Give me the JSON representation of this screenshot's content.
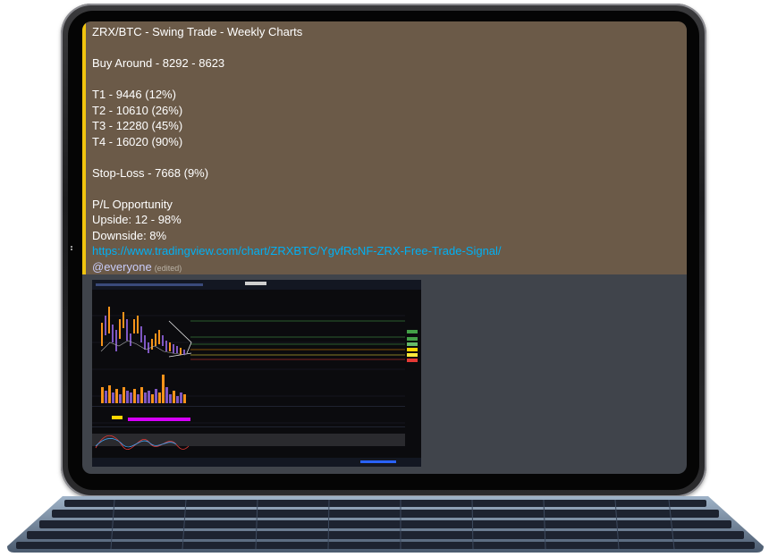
{
  "message": {
    "lines": [
      {
        "key": "title",
        "text": "ZRX/BTC - Swing Trade - Weekly Charts"
      },
      {
        "key": "blank1",
        "text": ""
      },
      {
        "key": "buy",
        "text": "Buy Around - 8292 - 8623"
      },
      {
        "key": "blank2",
        "text": ""
      },
      {
        "key": "t1",
        "text": "T1 - 9446 (12%)"
      },
      {
        "key": "t2",
        "text": "T2 - 10610 (26%)"
      },
      {
        "key": "t3",
        "text": "T3 - 12280 (45%)"
      },
      {
        "key": "t4",
        "text": "T4 - 16020 (90%)"
      },
      {
        "key": "blank3",
        "text": ""
      },
      {
        "key": "stop",
        "text": "Stop-Loss - 7668 (9%)"
      },
      {
        "key": "blank4",
        "text": ""
      },
      {
        "key": "pl",
        "text": "P/L Opportunity"
      },
      {
        "key": "upside",
        "text": "Upside: 12 - 98%"
      },
      {
        "key": "downside",
        "text": "Downside: 8%"
      }
    ],
    "link": "https://www.tradingview.com/chart/ZRXBTC/YgvfRcNF-ZRX-Free-Trade-Signal/",
    "mention": "@everyone",
    "edited": "(edited)"
  },
  "colors": {
    "embed_bg": "#6b5a48",
    "accent_bar": "#f1c40f",
    "link": "#00b0f4",
    "mention": "#c9cdfb",
    "chat_bg": "#40444b"
  },
  "icons": [
    "tradingview-chart-thumbnail",
    "keyboard"
  ]
}
